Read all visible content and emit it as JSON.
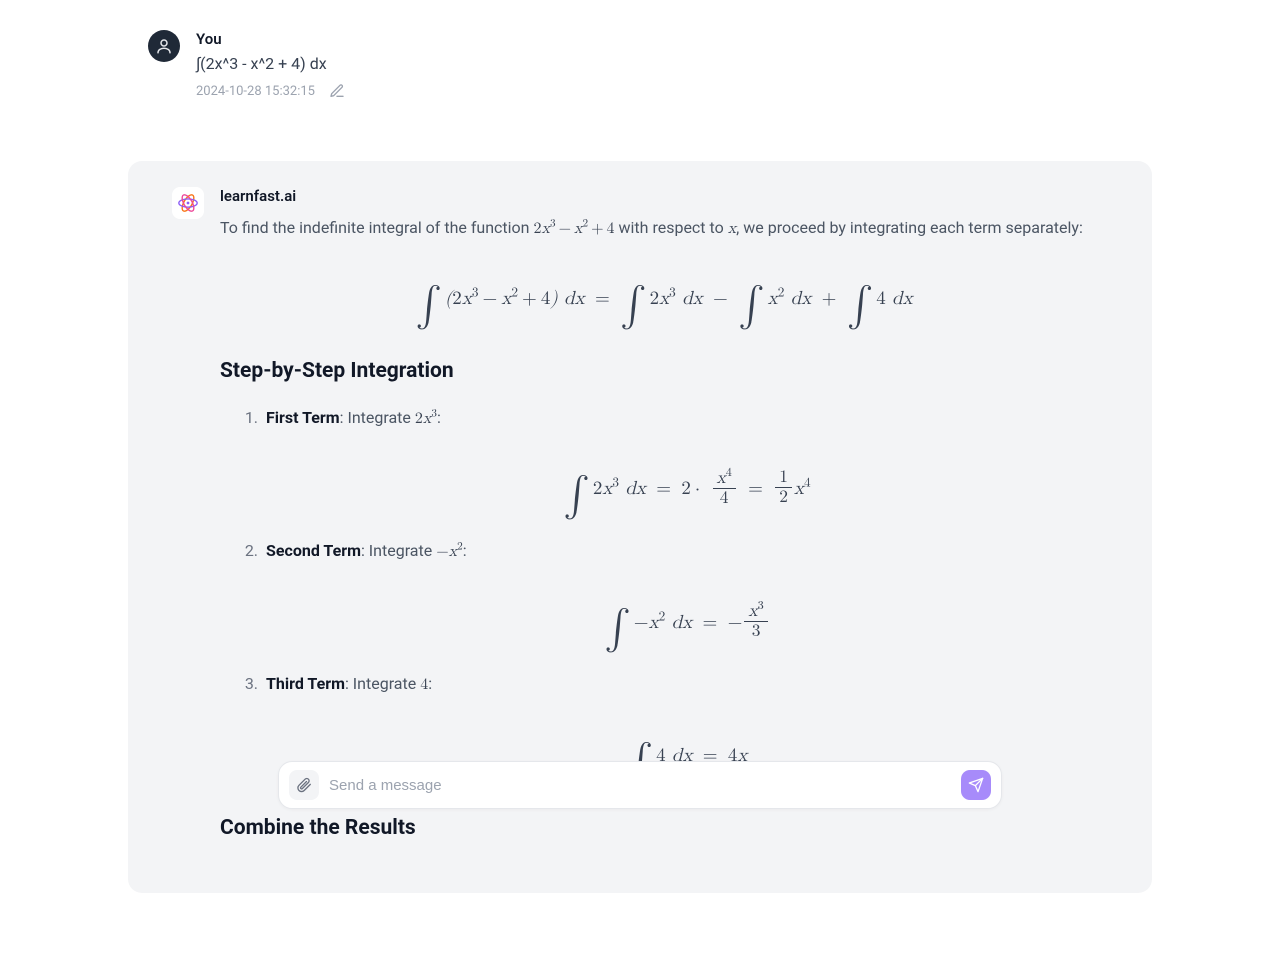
{
  "user": {
    "name": "You",
    "message": "∫(2x^3 - x^2 + 4) dx",
    "timestamp": "2024-10-28 15:32:15"
  },
  "ai": {
    "name": "learnfast.ai",
    "intro_before": "To find the indefinite integral of the function ",
    "intro_expr": "2x³ − x² + 4",
    "intro_mid": " with respect to ",
    "intro_var": "x",
    "intro_after": ", we proceed by integrating each term separately:",
    "heading1": "Step-by-Step Integration",
    "steps": [
      {
        "label": "First Term",
        "text": ": Integrate ",
        "expr": "2x³",
        "tail": ":"
      },
      {
        "label": "Second Term",
        "text": ": Integrate ",
        "expr": "−x²",
        "tail": ":"
      },
      {
        "label": "Third Term",
        "text": ": Integrate ",
        "expr": "4",
        "tail": ":"
      }
    ],
    "heading2": "Combine the Results"
  },
  "composer": {
    "placeholder": "Send a message"
  }
}
